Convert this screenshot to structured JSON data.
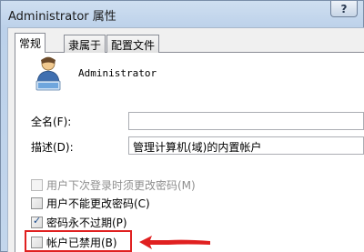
{
  "window": {
    "title": "Administrator 属性",
    "help_label": "?"
  },
  "tabs": [
    {
      "label": "常规",
      "active": true
    },
    {
      "label": "隶属于",
      "active": false
    },
    {
      "label": "配置文件",
      "active": false
    }
  ],
  "user": {
    "name": "Administrator",
    "icon": "user-icon"
  },
  "fields": {
    "full_name_label": "全名(F):",
    "full_name_value": "",
    "description_label": "描述(D):",
    "description_value": "管理计算机(域)的内置帐户"
  },
  "checkboxes": [
    {
      "label": "用户下次登录时须更改密码(M)",
      "checked": false,
      "disabled": true
    },
    {
      "label": "用户不能更改密码(C)",
      "checked": false,
      "disabled": false
    },
    {
      "label": "密码永不过期(P)",
      "checked": true,
      "disabled": false
    },
    {
      "label": "帐户已禁用(B)",
      "checked": false,
      "disabled": false
    }
  ],
  "colors": {
    "highlight": "#e02020",
    "title_bar": "#bcd1ea",
    "panel": "#ffffff"
  }
}
